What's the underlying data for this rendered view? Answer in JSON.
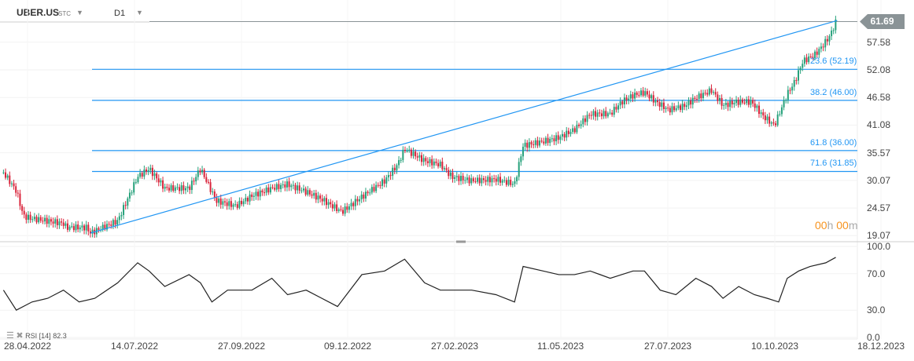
{
  "header": {
    "symbol": "UBER.US",
    "type": "STC",
    "timeframe": "D1"
  },
  "last_price": "61.69",
  "timer": {
    "h": "00",
    "h_unit": "h",
    "m": "00",
    "m_unit": "m"
  },
  "rsi_label": {
    "name": "RSI",
    "period": "[14]",
    "value": "82.3"
  },
  "colors": {
    "up": "#26a17b",
    "down": "#d9233a",
    "fib": "#2196f3",
    "line": "#222222"
  },
  "chart_data": [
    {
      "type": "candlestick",
      "title": "UBER.US D1",
      "price_axis": [
        "57.58",
        "52.08",
        "46.58",
        "41.08",
        "35.57",
        "30.07",
        "24.57",
        "19.07"
      ],
      "ylim": [
        19.07,
        61.69
      ],
      "date_axis": [
        "28.04.2022",
        "14.07.2022",
        "27.09.2022",
        "09.12.2022",
        "27.02.2023",
        "11.05.2023",
        "27.07.2023",
        "10.10.2023",
        "18.12.2023"
      ],
      "x_unit": "days since 28.04.2022",
      "closes": [
        [
          -13,
          31.6
        ],
        [
          -4,
          28
        ],
        [
          1,
          23
        ],
        [
          6,
          22.5
        ],
        [
          18,
          22
        ],
        [
          29,
          21.5
        ],
        [
          31,
          20.7
        ],
        [
          45,
          20.7
        ],
        [
          48,
          19.6
        ],
        [
          67,
          22
        ],
        [
          81,
          30.8
        ],
        [
          89,
          32.4
        ],
        [
          100,
          28.5
        ],
        [
          117,
          28.5
        ],
        [
          125,
          32.4
        ],
        [
          136,
          26
        ],
        [
          150,
          25
        ],
        [
          161,
          27
        ],
        [
          175,
          28.5
        ],
        [
          186,
          29.3
        ],
        [
          199,
          27.8
        ],
        [
          210,
          26.3
        ],
        [
          224,
          23.8
        ],
        [
          238,
          26.8
        ],
        [
          254,
          30
        ],
        [
          263,
          33.2
        ],
        [
          268,
          36.3
        ],
        [
          282,
          34
        ],
        [
          293,
          33.2
        ],
        [
          301,
          30.8
        ],
        [
          315,
          30
        ],
        [
          332,
          30.3
        ],
        [
          345,
          29.3
        ],
        [
          351,
          37
        ],
        [
          365,
          37.8
        ],
        [
          376,
          38.6
        ],
        [
          387,
          40.2
        ],
        [
          398,
          43.3
        ],
        [
          412,
          43.3
        ],
        [
          420,
          45.7
        ],
        [
          428,
          47
        ],
        [
          436,
          47.6
        ],
        [
          444,
          45.7
        ],
        [
          453,
          44.1
        ],
        [
          464,
          44.9
        ],
        [
          472,
          46.5
        ],
        [
          483,
          48
        ],
        [
          491,
          45
        ],
        [
          500,
          45.7
        ],
        [
          511,
          45.7
        ],
        [
          519,
          42.9
        ],
        [
          527,
          41
        ],
        [
          536,
          47.3
        ],
        [
          541,
          49.6
        ],
        [
          547,
          53.8
        ],
        [
          555,
          55
        ],
        [
          560,
          56.6
        ],
        [
          566,
          58.9
        ],
        [
          570,
          61.6
        ]
      ],
      "trendline": {
        "from": [
          48,
          19.6
        ],
        "to": [
          571,
          61.9
        ]
      },
      "fibonacci": [
        {
          "label": "23.6 (52.19)",
          "value": 52.19
        },
        {
          "label": "38.2 (46.00)",
          "value": 46.0
        },
        {
          "label": "61.8 (36.00)",
          "value": 36.0
        },
        {
          "label": "71.6 (31.85)",
          "value": 31.85
        }
      ]
    },
    {
      "type": "line",
      "title": "RSI [14]",
      "ylim": [
        0,
        100
      ],
      "y_axis": [
        "100.0",
        "70.0",
        "30.0",
        "0.0"
      ],
      "values": [
        [
          -13,
          52
        ],
        [
          -4,
          30
        ],
        [
          7,
          39
        ],
        [
          18,
          43
        ],
        [
          29,
          52
        ],
        [
          40,
          39
        ],
        [
          51,
          43
        ],
        [
          67,
          60
        ],
        [
          81,
          82
        ],
        [
          89,
          73
        ],
        [
          100,
          56
        ],
        [
          117,
          69
        ],
        [
          125,
          60
        ],
        [
          133,
          39
        ],
        [
          144,
          52
        ],
        [
          161,
          52
        ],
        [
          175,
          65
        ],
        [
          186,
          47
        ],
        [
          199,
          52
        ],
        [
          210,
          43
        ],
        [
          221,
          34
        ],
        [
          238,
          69
        ],
        [
          254,
          73
        ],
        [
          268,
          86
        ],
        [
          282,
          60
        ],
        [
          293,
          52
        ],
        [
          304,
          52
        ],
        [
          315,
          52
        ],
        [
          332,
          47
        ],
        [
          345,
          39
        ],
        [
          351,
          78
        ],
        [
          365,
          73
        ],
        [
          376,
          69
        ],
        [
          387,
          69
        ],
        [
          398,
          73
        ],
        [
          412,
          65
        ],
        [
          420,
          69
        ],
        [
          428,
          73
        ],
        [
          436,
          73
        ],
        [
          447,
          52
        ],
        [
          458,
          47
        ],
        [
          472,
          65
        ],
        [
          483,
          56
        ],
        [
          491,
          43
        ],
        [
          502,
          56
        ],
        [
          513,
          47
        ],
        [
          522,
          43
        ],
        [
          530,
          39
        ],
        [
          536,
          65
        ],
        [
          544,
          73
        ],
        [
          552,
          78
        ],
        [
          563,
          82
        ],
        [
          570,
          88
        ]
      ]
    }
  ]
}
